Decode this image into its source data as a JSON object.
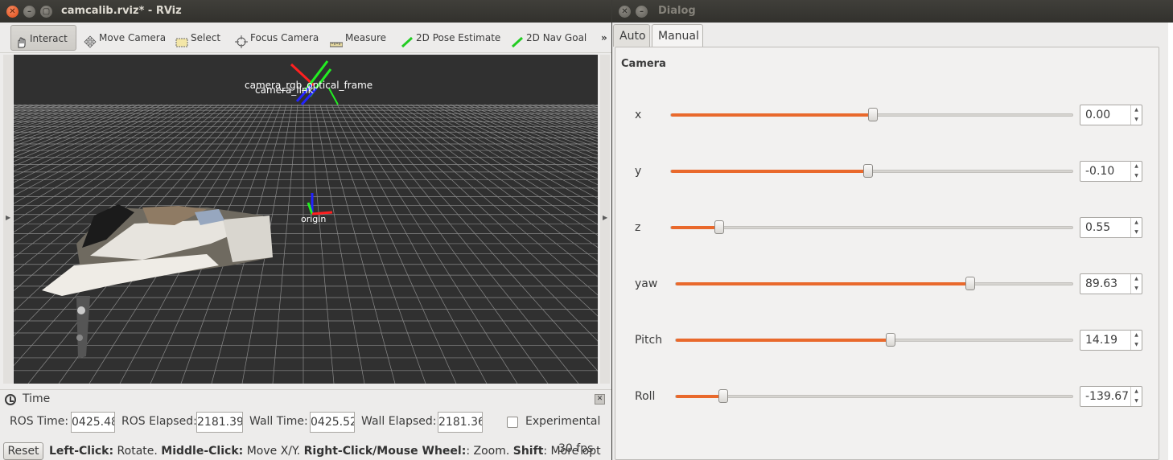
{
  "rviz": {
    "title": "camcalib.rviz* - RViz",
    "toolbar": {
      "interact": "Interact",
      "move_camera": "Move Camera",
      "select": "Select",
      "focus_camera": "Focus Camera",
      "measure": "Measure",
      "pose_estimate": "2D Pose Estimate",
      "nav_goal": "2D Nav Goal",
      "more": "»"
    },
    "viewport": {
      "frame_label": "camera_rgb_optical_frame",
      "frame_label2": "camera_link",
      "origin_label": "origin"
    },
    "time_panel": {
      "title": "Time",
      "ros_time_label": "ROS Time:",
      "ros_time": "0425.48",
      "ros_elapsed_label": "ROS Elapsed:",
      "ros_elapsed": "2181.39",
      "wall_time_label": "Wall Time:",
      "wall_time": "0425.52",
      "wall_elapsed_label": "Wall Elapsed:",
      "wall_elapsed": "2181.36",
      "experimental_label": "Experimental"
    },
    "status": {
      "reset_label": "Reset",
      "left_click": "Left-Click:",
      "left_click_desc": " Rotate. ",
      "middle_click": "Middle-Click:",
      "middle_click_desc": " Move X/Y. ",
      "right_click": "Right-Click/Mouse Wheel:",
      "right_click_desc": ": Zoom. ",
      "shift": "Shift",
      "shift_desc": ": More opt",
      "fps": "30 fps"
    }
  },
  "dialog": {
    "title": "Dialog",
    "tabs": [
      "Auto",
      "Manual"
    ],
    "active_tab": "Manual",
    "section": "Camera",
    "sliders": [
      {
        "label": "x",
        "value": "0.00",
        "fraction": 0.5
      },
      {
        "label": "y",
        "value": "-0.10",
        "fraction": 0.49
      },
      {
        "label": "z",
        "value": "0.55",
        "fraction": 0.12
      },
      {
        "label": "yaw",
        "value": "89.63",
        "fraction": 0.74
      },
      {
        "label": "Pitch",
        "value": "14.19",
        "fraction": 0.54
      },
      {
        "label": "Roll",
        "value": "-139.67",
        "fraction": 0.12
      }
    ],
    "accent_color": "#e9692c"
  }
}
